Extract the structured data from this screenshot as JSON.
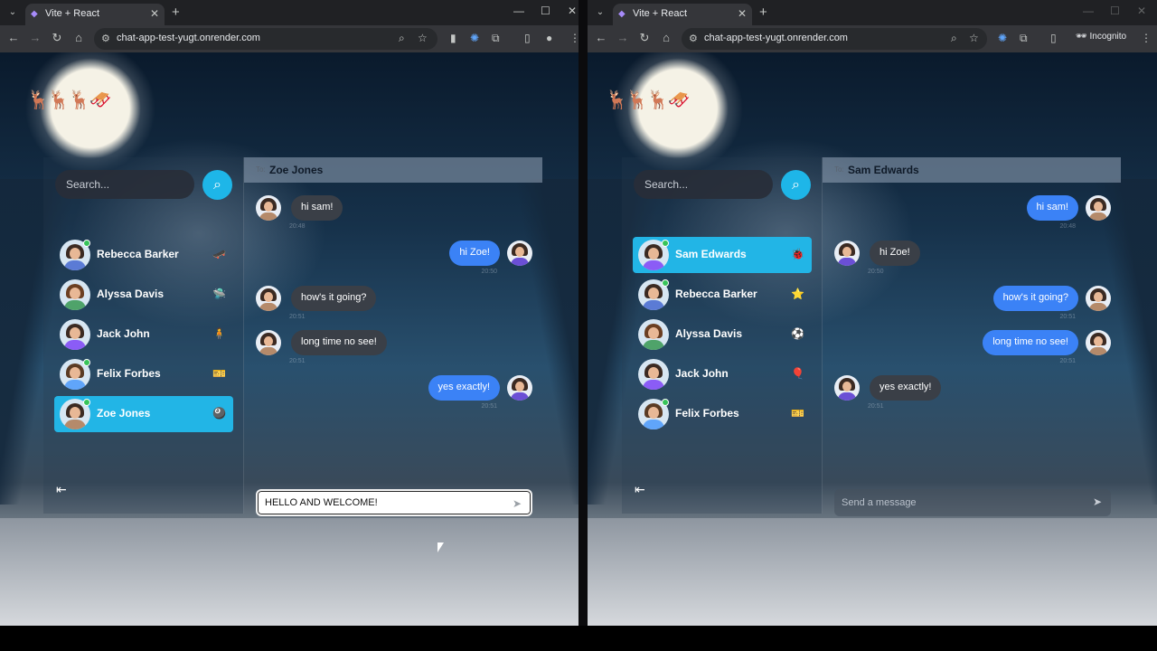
{
  "left": {
    "tab_title": "Vite + React",
    "url": "chat-app-test-yugt.onrender.com",
    "search_placeholder": "Search...",
    "conversations": [
      {
        "name": "Rebecca Barker",
        "emoji": "🛹",
        "online": true,
        "active": false
      },
      {
        "name": "Alyssa Davis",
        "emoji": "🛸",
        "online": false,
        "active": false
      },
      {
        "name": "Jack John",
        "emoji": "🧍",
        "online": false,
        "active": false
      },
      {
        "name": "Felix Forbes",
        "emoji": "🎫",
        "online": true,
        "active": false
      },
      {
        "name": "Zoe Jones",
        "emoji": "🎱",
        "online": true,
        "active": true
      }
    ],
    "chat": {
      "to_label": "To:",
      "recipient": "Zoe Jones",
      "messages": [
        {
          "text": "hi sam!",
          "time": "20:48",
          "from_me": false
        },
        {
          "text": "hi Zoe!",
          "time": "20:50",
          "from_me": true
        },
        {
          "text": "how's it going?",
          "time": "20:51",
          "from_me": false
        },
        {
          "text": "long time no see!",
          "time": "20:51",
          "from_me": false
        },
        {
          "text": "yes exactly!",
          "time": "20:51",
          "from_me": true
        }
      ],
      "input_value": "HELLO AND WELCOME!",
      "input_placeholder": "Send a message"
    }
  },
  "right": {
    "tab_title": "Vite + React",
    "url": "chat-app-test-yugt.onrender.com",
    "incognito_label": "Incognito",
    "search_placeholder": "Search...",
    "conversations": [
      {
        "name": "Sam Edwards",
        "emoji": "🐞",
        "online": true,
        "active": true
      },
      {
        "name": "Rebecca Barker",
        "emoji": "⭐",
        "online": true,
        "active": false
      },
      {
        "name": "Alyssa Davis",
        "emoji": "⚽",
        "online": false,
        "active": false
      },
      {
        "name": "Jack John",
        "emoji": "🎈",
        "online": false,
        "active": false
      },
      {
        "name": "Felix Forbes",
        "emoji": "🎫",
        "online": true,
        "active": false
      }
    ],
    "chat": {
      "to_label": "To:",
      "recipient": "Sam Edwards",
      "messages": [
        {
          "text": "hi sam!",
          "time": "20:48",
          "from_me": true
        },
        {
          "text": "hi Zoe!",
          "time": "20:50",
          "from_me": false
        },
        {
          "text": "how's it going?",
          "time": "20:51",
          "from_me": true
        },
        {
          "text": "long time no see!",
          "time": "20:51",
          "from_me": true
        },
        {
          "text": "yes exactly!",
          "time": "20:51",
          "from_me": false
        }
      ],
      "input_value": "",
      "input_placeholder": "Send a message"
    }
  },
  "colors": {
    "accent": "#22b5e6",
    "my_bubble": "#3b82f6",
    "their_bubble": "#3a3f47",
    "online": "#37c45a"
  },
  "icons": {
    "back": "←",
    "forward": "→",
    "reload": "↻",
    "home": "⌂",
    "zoom": "🔍",
    "star": "☆",
    "search": "🔍",
    "send": "➤",
    "logout": "⇤",
    "close": "✕",
    "new_tab": "+",
    "minimize": "—",
    "maximize": "☐",
    "menu": "⋮"
  }
}
